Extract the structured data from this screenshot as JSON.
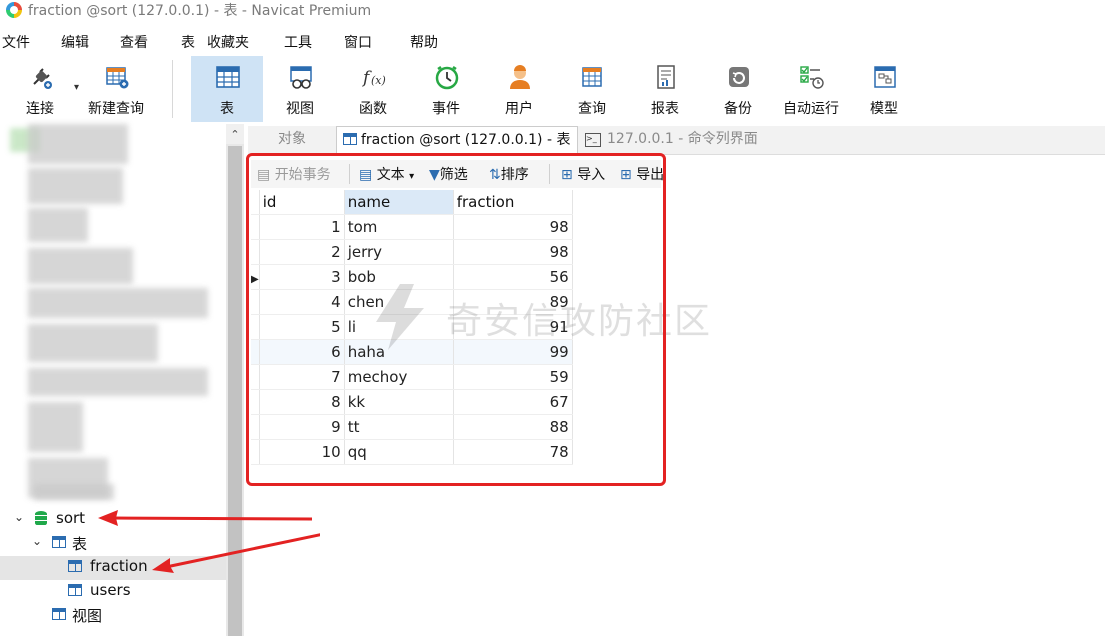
{
  "window": {
    "title": "fraction @sort (127.0.0.1) - 表 - Navicat Premium"
  },
  "menu": [
    "文件",
    "编辑",
    "查看",
    "表",
    "收藏夹",
    "工具",
    "窗口",
    "帮助"
  ],
  "toolbar": [
    {
      "label": "连接",
      "icon": "plug-icon"
    },
    {
      "label": "新建查询",
      "icon": "new-query-icon"
    },
    {
      "label": "表",
      "icon": "table-icon",
      "active": true
    },
    {
      "label": "视图",
      "icon": "view-icon"
    },
    {
      "label": "函数",
      "icon": "function-icon"
    },
    {
      "label": "事件",
      "icon": "clock-icon"
    },
    {
      "label": "用户",
      "icon": "user-icon"
    },
    {
      "label": "查询",
      "icon": "query-icon"
    },
    {
      "label": "报表",
      "icon": "report-icon"
    },
    {
      "label": "备份",
      "icon": "backup-icon"
    },
    {
      "label": "自动运行",
      "icon": "automation-icon"
    },
    {
      "label": "模型",
      "icon": "model-icon"
    }
  ],
  "tabs": {
    "objects": "对象",
    "table_tab": "fraction @sort (127.0.0.1) - 表",
    "console_tab": "127.0.0.1 - 命令列界面"
  },
  "table_toolbar": {
    "begin_tx": "开始事务",
    "text": "文本",
    "filter": "筛选",
    "sort": "排序",
    "import": "导入",
    "export": "导出"
  },
  "grid": {
    "columns": [
      "id",
      "name",
      "fraction"
    ],
    "rows": [
      [
        "1",
        "tom",
        "98"
      ],
      [
        "2",
        "jerry",
        "98"
      ],
      [
        "3",
        "bob",
        "56"
      ],
      [
        "4",
        "chen",
        "89"
      ],
      [
        "5",
        "li",
        "91"
      ],
      [
        "6",
        "haha",
        "99"
      ],
      [
        "7",
        "mechoy",
        "59"
      ],
      [
        "8",
        "kk",
        "67"
      ],
      [
        "9",
        "tt",
        "88"
      ],
      [
        "10",
        "qq",
        "78"
      ]
    ],
    "current_row": 3
  },
  "tree": {
    "db": "sort",
    "tables_group": "表",
    "tables": [
      "fraction",
      "users"
    ],
    "views_group": "视图",
    "selected": "fraction"
  },
  "watermark": "奇安信攻防社区",
  "colors": {
    "accent": "#2b6cb0",
    "annotation": "#e32222",
    "active_button": "#cfe3f5"
  }
}
